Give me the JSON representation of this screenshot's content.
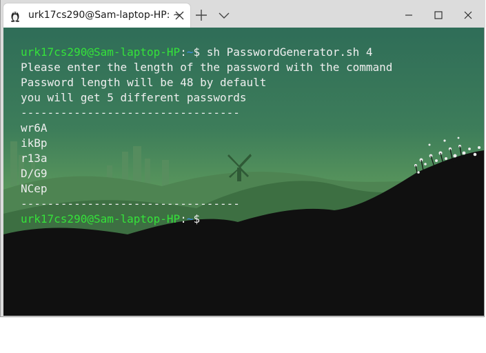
{
  "window": {
    "tab_title": "urk17cs290@Sam-laptop-HP: ~"
  },
  "colors": {
    "prompt_user": "#35e23a",
    "prompt_path": "#3b8eea",
    "text": "#efefef"
  },
  "icons": {
    "tab": "linux-penguin-icon",
    "tab_close": "close-icon",
    "new_tab": "plus-icon",
    "dropdown": "chevron-down-icon",
    "minimize": "minimize-icon",
    "maximize": "maximize-icon",
    "close": "close-icon"
  },
  "terminal": {
    "prompt1": {
      "user": "urk17cs290@Sam-laptop-HP",
      "sep": ":",
      "path": "~",
      "symbol": "$",
      "command": " sh PasswordGenerator.sh 4"
    },
    "output": [
      "Please enter the length of the password with the command",
      "Password length will be 48 by default",
      "you will get 5 different passwords",
      "---------------------------------",
      "wr6A",
      "ikBp",
      "r13a",
      "D/G9",
      "NCep",
      "---------------------------------"
    ],
    "prompt2": {
      "user": "urk17cs290@Sam-laptop-HP",
      "sep": ":",
      "path": "~",
      "symbol": "$"
    }
  }
}
